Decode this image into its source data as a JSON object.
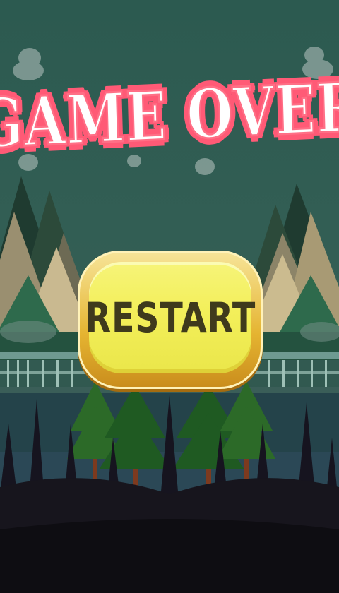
{
  "game": {
    "title": "GAME OVER",
    "restart_label": "RESTART"
  },
  "colors": {
    "sky": "#2f5a50",
    "title_fill": "#ffffff",
    "title_outline": "#ff5a76",
    "button_fill": "#f3ef5a",
    "button_rim": "#e5b431",
    "button_text": "#3f3a1c",
    "ground": "#15131c"
  },
  "icons": [
    "cloud-icon",
    "mountain-icon",
    "pine-tree-icon",
    "fence-icon"
  ]
}
